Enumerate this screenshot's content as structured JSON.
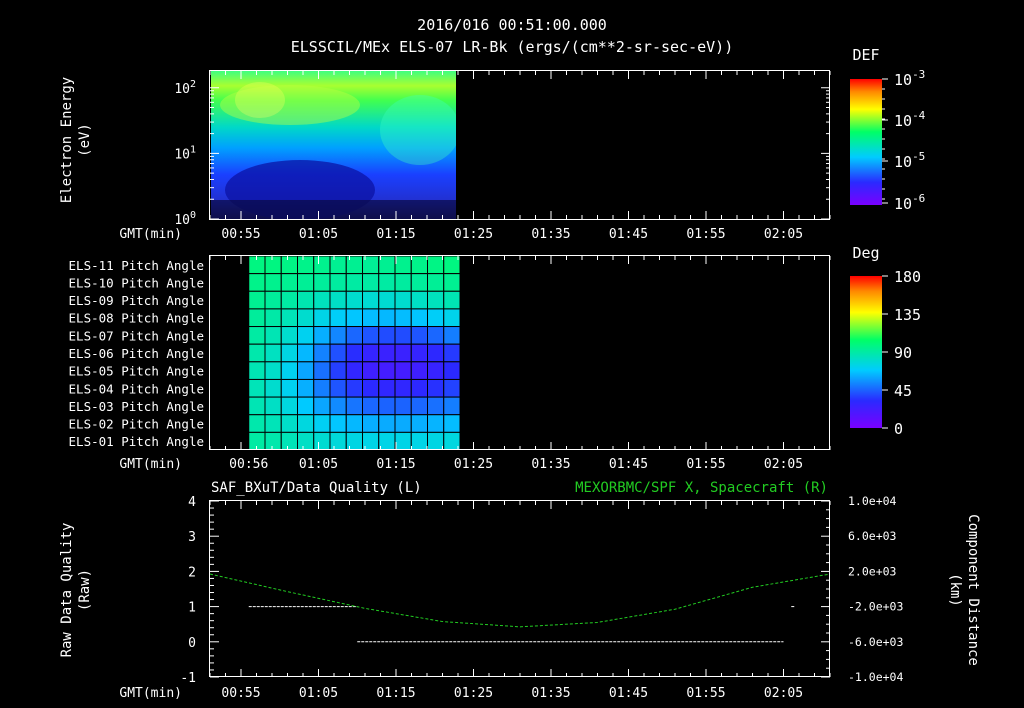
{
  "header": {
    "datetime": "2016/016 00:51:00.000",
    "title": "ELSSCIL/MEx ELS-07 LR-Bk  (ergs/(cm**2-sr-sec-eV))"
  },
  "colors": {
    "background": "#000000",
    "axis": "#ffffff",
    "spacecraft_series": "#22cc22",
    "quality_series": "#ffffff"
  },
  "chart_data": [
    {
      "id": "energy_spectrogram",
      "type": "heatmap",
      "ylabel": "Electron Energy",
      "ylabel2": "(eV)",
      "xlabel": "GMT(min)",
      "x_ticks": [
        "00:55",
        "01:05",
        "01:15",
        "01:25",
        "01:35",
        "01:45",
        "01:55",
        "02:05"
      ],
      "y_scale": "log",
      "y_ticks": [
        {
          "base": "10",
          "exp": "0",
          "value": 1
        },
        {
          "base": "10",
          "exp": "1",
          "value": 10
        },
        {
          "base": "10",
          "exp": "2",
          "value": 100
        }
      ],
      "ylim": [
        1,
        180
      ],
      "data_time_range": [
        "00:51",
        "01:23"
      ],
      "colorbar": {
        "title": "DEF",
        "scale": "log",
        "labels": [
          {
            "base": "10",
            "exp": "-3"
          },
          {
            "base": "10",
            "exp": "-4"
          },
          {
            "base": "10",
            "exp": "-5"
          },
          {
            "base": "10",
            "exp": "-6"
          }
        ]
      }
    },
    {
      "id": "pitch_angle",
      "type": "heatmap",
      "xlabel": "GMT(min)",
      "x_ticks": [
        "00:56",
        "01:05",
        "01:15",
        "01:25",
        "01:35",
        "01:45",
        "01:55",
        "02:05"
      ],
      "rows": [
        "ELS-11 Pitch Angle",
        "ELS-10 Pitch Angle",
        "ELS-09 Pitch Angle",
        "ELS-08 Pitch Angle",
        "ELS-07 Pitch Angle",
        "ELS-06 Pitch Angle",
        "ELS-05 Pitch Angle",
        "ELS-04 Pitch Angle",
        "ELS-03 Pitch Angle",
        "ELS-02 Pitch Angle",
        "ELS-01 Pitch Angle"
      ],
      "data_time_range": [
        "00:56",
        "01:23"
      ],
      "values": [
        [
          98,
          98,
          97,
          96,
          95,
          94,
          94,
          93,
          94,
          95,
          96,
          97,
          98
        ],
        [
          96,
          95,
          94,
          93,
          92,
          91,
          90,
          90,
          90,
          91,
          92,
          93,
          94
        ],
        [
          94,
          92,
          90,
          87,
          84,
          82,
          80,
          79,
          79,
          80,
          82,
          84,
          86
        ],
        [
          92,
          89,
          85,
          80,
          74,
          70,
          67,
          65,
          64,
          65,
          67,
          70,
          73
        ],
        [
          90,
          86,
          80,
          72,
          62,
          53,
          46,
          42,
          40,
          40,
          42,
          46,
          51
        ],
        [
          88,
          83,
          75,
          64,
          52,
          41,
          33,
          28,
          26,
          26,
          28,
          31,
          36
        ],
        [
          86,
          81,
          72,
          60,
          48,
          37,
          29,
          24,
          22,
          22,
          24,
          27,
          32
        ],
        [
          85,
          80,
          72,
          62,
          51,
          42,
          36,
          32,
          30,
          30,
          31,
          34,
          38
        ],
        [
          86,
          82,
          76,
          68,
          60,
          54,
          49,
          46,
          45,
          45,
          46,
          48,
          51
        ],
        [
          88,
          85,
          81,
          76,
          71,
          67,
          64,
          62,
          61,
          61,
          62,
          63,
          65
        ],
        [
          90,
          88,
          85,
          82,
          79,
          77,
          75,
          74,
          74,
          74,
          74,
          75,
          76
        ]
      ],
      "colorbar": {
        "title": "Deg",
        "range": [
          0,
          180
        ],
        "labels": [
          "180",
          "135",
          "90",
          "45",
          "0"
        ]
      }
    },
    {
      "id": "quality_and_position",
      "type": "line",
      "title_left": "SAF_BXuT/Data Quality (L)",
      "title_right": "MEXORBMC/SPF X, Spacecraft (R)",
      "xlabel": "GMT(min)",
      "x_ticks": [
        "00:55",
        "01:05",
        "01:15",
        "01:25",
        "01:35",
        "01:45",
        "01:55",
        "02:05"
      ],
      "ylabel_left": "Raw Data Quality",
      "ylabel_left2": "(Raw)",
      "ylim_left": [
        -1,
        4
      ],
      "y_ticks_left": [
        "4",
        "3",
        "2",
        "1",
        "0",
        "-1"
      ],
      "ylabel_right": "Component Distance",
      "ylabel_right2": "(km)",
      "ylim_right": [
        -10000,
        10000
      ],
      "y_ticks_right": [
        "1.0e+04",
        "6.0e+03",
        "2.0e+03",
        "-2.0e+03",
        "-6.0e+03",
        "-1.0e+04"
      ],
      "series": [
        {
          "axis": "left",
          "segments": [
            {
              "x_start": "00:56",
              "x_end": "01:10",
              "y": 1
            },
            {
              "x_start": "01:10",
              "x_end": "02:05",
              "y": 0
            },
            {
              "x_start": "02:06",
              "x_end": "02:06",
              "y": 1
            }
          ]
        },
        {
          "axis": "right",
          "x": [
            "00:51",
            "01:01",
            "01:11",
            "01:21",
            "01:31",
            "01:41",
            "01:51",
            "02:01",
            "02:11"
          ],
          "values": [
            1700,
            -300,
            -2200,
            -3700,
            -4300,
            -3800,
            -2300,
            200,
            1700
          ]
        }
      ]
    }
  ]
}
